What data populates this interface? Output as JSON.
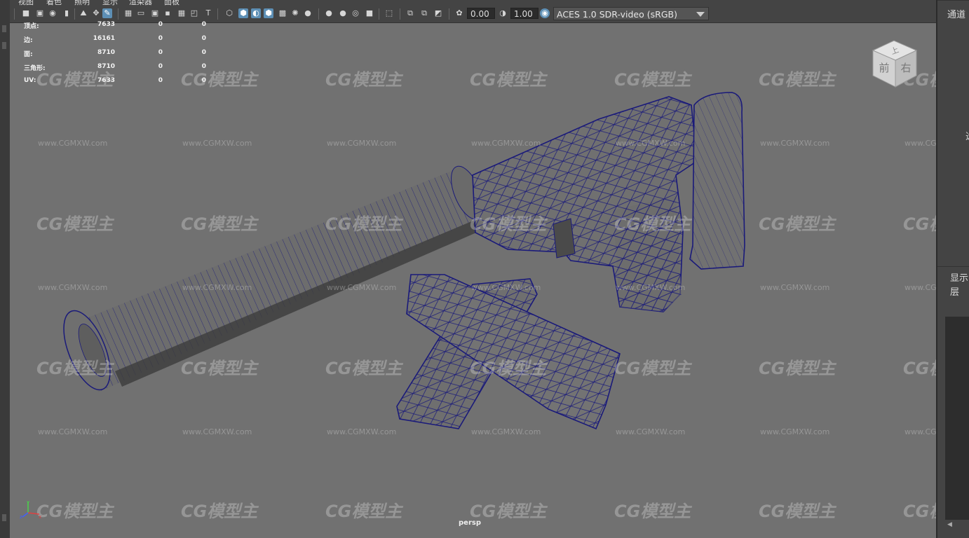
{
  "menubar": {
    "items": [
      "视图",
      "着色",
      "照明",
      "显示",
      "渲染器",
      "面板"
    ]
  },
  "toolbar": {
    "exposure_value": "0.00",
    "gamma_value": "1.00",
    "color_space": "ACES 1.0 SDR-video (sRGB)",
    "icons": [
      "camera-select-icon",
      "camera-lock-icon",
      "camera-attributes-icon",
      "bookmark-icon",
      "image-plane-icon",
      "2d-pan-zoom-icon",
      "grease-pencil-icon",
      "grid-icon",
      "film-gate-icon",
      "resolution-gate-icon",
      "gate-mask-icon",
      "field-chart-icon",
      "safe-action-icon",
      "safe-title-icon",
      "wireframe-icon",
      "smooth-shade-icon",
      "wireframe-on-shaded-icon",
      "textured-icon",
      "lighting-icon",
      "shadows-icon",
      "ambient-occlusion-icon",
      "motion-blur-icon",
      "anti-aliasing-icon",
      "depth-of-field-icon",
      "isolate-select-icon",
      "xray-icon",
      "xray-joints-icon",
      "backface-culling-icon",
      "exposure-icon",
      "gamma-icon",
      "color-management-icon"
    ]
  },
  "hud": {
    "rows": [
      {
        "label": "顶点:",
        "v1": "7633",
        "v2": "0",
        "v3": "0"
      },
      {
        "label": "边:",
        "v1": "16161",
        "v2": "0",
        "v3": "0"
      },
      {
        "label": "面:",
        "v1": "8710",
        "v2": "0",
        "v3": "0"
      },
      {
        "label": "三角形:",
        "v1": "8710",
        "v2": "0",
        "v3": "0"
      },
      {
        "label": "UV:",
        "v1": "7633",
        "v2": "0",
        "v3": "0"
      }
    ]
  },
  "viewcube": {
    "top": "上",
    "front": "前",
    "right": "右"
  },
  "camera_label": "persp",
  "axis": {
    "x": "x",
    "y": "y",
    "z": "z"
  },
  "watermark": {
    "logo": "CG模型主",
    "url": "www.CGMXW.com"
  },
  "right_panel": {
    "channels": "通道",
    "side_char": "选",
    "display": "显示",
    "layers": "层"
  },
  "colors": {
    "viewport_bg": "#717171",
    "wire": "#1a1a7a",
    "ui_dark": "#444444",
    "active_icon": "#5d8fb5"
  }
}
